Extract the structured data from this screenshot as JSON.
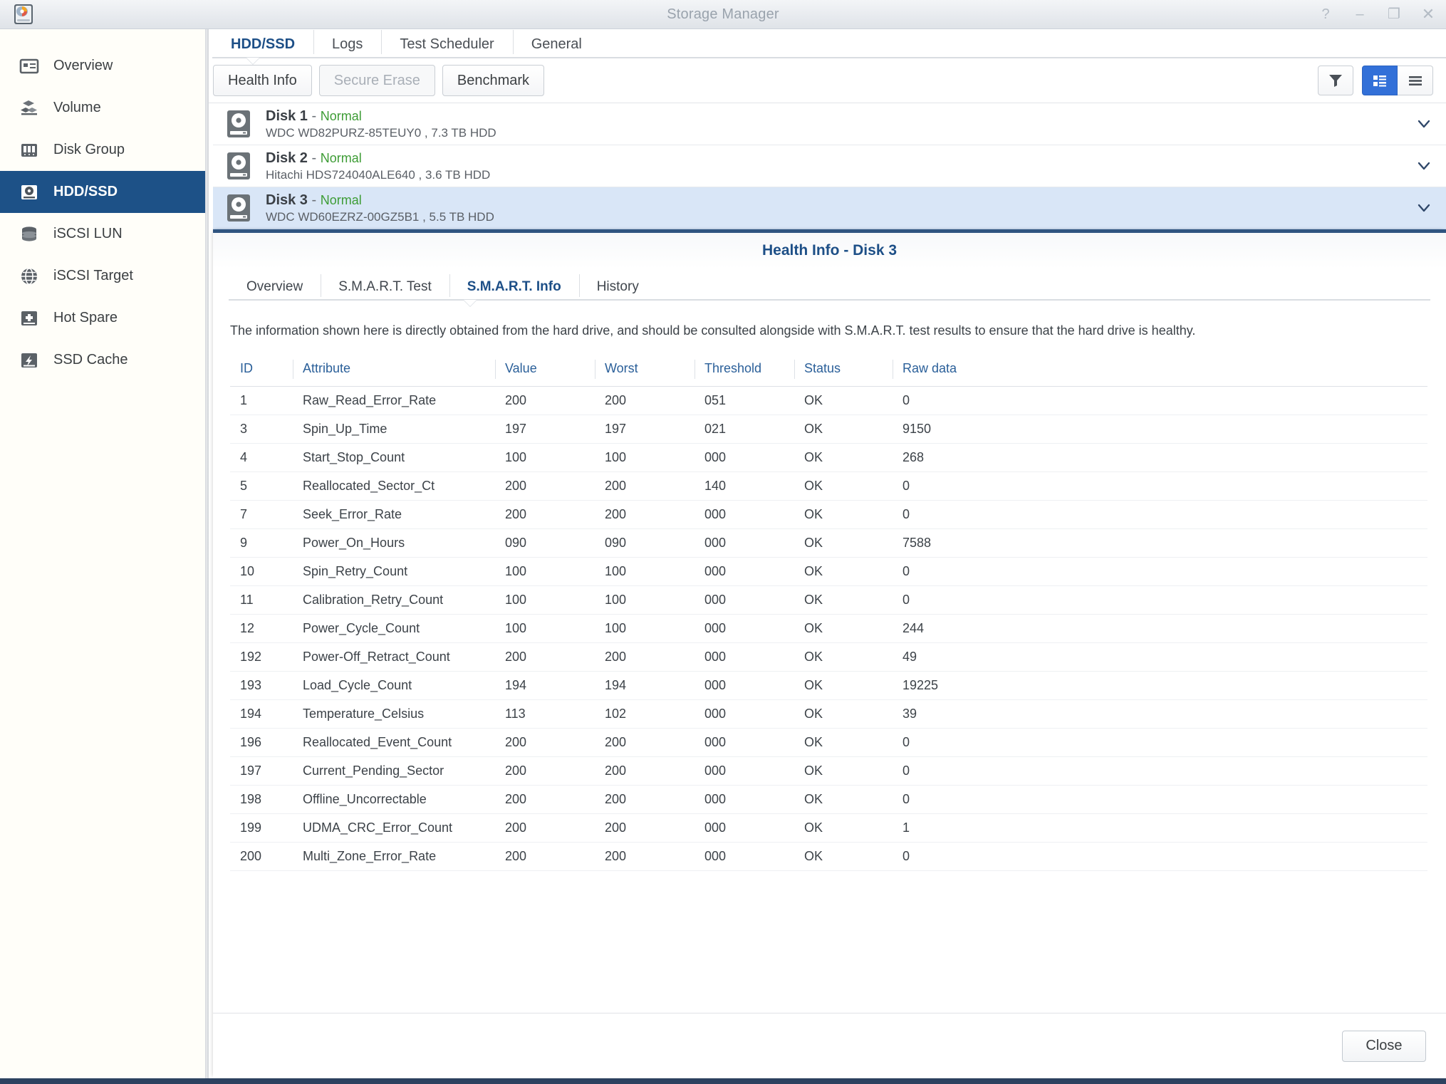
{
  "window": {
    "title": "Storage Manager",
    "controls": [
      {
        "name": "help-button",
        "glyph": "?"
      },
      {
        "name": "minimize-button",
        "glyph": "–"
      },
      {
        "name": "maximize-button",
        "glyph": "❐"
      },
      {
        "name": "close-window-button",
        "glyph": "✕"
      }
    ]
  },
  "sidebar": {
    "items": [
      {
        "label": "Overview",
        "icon": "overview-icon",
        "active": false
      },
      {
        "label": "Volume",
        "icon": "volume-icon",
        "active": false
      },
      {
        "label": "Disk Group",
        "icon": "disk-group-icon",
        "active": false
      },
      {
        "label": "HDD/SSD",
        "icon": "hdd-ssd-icon",
        "active": true
      },
      {
        "label": "iSCSI LUN",
        "icon": "iscsi-lun-icon",
        "active": false
      },
      {
        "label": "iSCSI Target",
        "icon": "iscsi-target-icon",
        "active": false
      },
      {
        "label": "Hot Spare",
        "icon": "hot-spare-icon",
        "active": false
      },
      {
        "label": "SSD Cache",
        "icon": "ssd-cache-icon",
        "active": false
      }
    ]
  },
  "main": {
    "tabs": [
      {
        "label": "HDD/SSD",
        "active": true
      },
      {
        "label": "Logs",
        "active": false
      },
      {
        "label": "Test Scheduler",
        "active": false
      },
      {
        "label": "General",
        "active": false
      }
    ],
    "toolbar": {
      "health_info_label": "Health Info",
      "secure_erase_label": "Secure Erase",
      "benchmark_label": "Benchmark",
      "filter_icon": "filter-icon",
      "detail_view_icon": "detail-view-icon",
      "list_view_icon": "list-view-icon"
    },
    "disks": [
      {
        "name": "Disk 1",
        "separator": "-",
        "status": "Normal",
        "model": "WDC WD82PURZ-85TEUY0 , 7.3 TB HDD",
        "selected": false
      },
      {
        "name": "Disk 2",
        "separator": "-",
        "status": "Normal",
        "model": "Hitachi HDS724040ALE640 , 3.6 TB HDD",
        "selected": false
      },
      {
        "name": "Disk 3",
        "separator": "-",
        "status": "Normal",
        "model": "WDC WD60EZRZ-00GZ5B1 , 5.5 TB HDD",
        "selected": true
      }
    ]
  },
  "health_panel": {
    "title": "Health Info - Disk 3",
    "tabs": [
      {
        "label": "Overview",
        "active": false
      },
      {
        "label": "S.M.A.R.T. Test",
        "active": false
      },
      {
        "label": "S.M.A.R.T. Info",
        "active": true
      },
      {
        "label": "History",
        "active": false
      }
    ],
    "description": "The information shown here is directly obtained from the hard drive, and should be consulted alongside with S.M.A.R.T. test results to ensure that the hard drive is healthy.",
    "close_label": "Close",
    "table": {
      "columns": [
        "ID",
        "Attribute",
        "Value",
        "Worst",
        "Threshold",
        "Status",
        "Raw data"
      ],
      "rows": [
        [
          "1",
          "Raw_Read_Error_Rate",
          "200",
          "200",
          "051",
          "OK",
          "0"
        ],
        [
          "3",
          "Spin_Up_Time",
          "197",
          "197",
          "021",
          "OK",
          "9150"
        ],
        [
          "4",
          "Start_Stop_Count",
          "100",
          "100",
          "000",
          "OK",
          "268"
        ],
        [
          "5",
          "Reallocated_Sector_Ct",
          "200",
          "200",
          "140",
          "OK",
          "0"
        ],
        [
          "7",
          "Seek_Error_Rate",
          "200",
          "200",
          "000",
          "OK",
          "0"
        ],
        [
          "9",
          "Power_On_Hours",
          "090",
          "090",
          "000",
          "OK",
          "7588"
        ],
        [
          "10",
          "Spin_Retry_Count",
          "100",
          "100",
          "000",
          "OK",
          "0"
        ],
        [
          "11",
          "Calibration_Retry_Count",
          "100",
          "100",
          "000",
          "OK",
          "0"
        ],
        [
          "12",
          "Power_Cycle_Count",
          "100",
          "100",
          "000",
          "OK",
          "244"
        ],
        [
          "192",
          "Power-Off_Retract_Count",
          "200",
          "200",
          "000",
          "OK",
          "49"
        ],
        [
          "193",
          "Load_Cycle_Count",
          "194",
          "194",
          "000",
          "OK",
          "19225"
        ],
        [
          "194",
          "Temperature_Celsius",
          "113",
          "102",
          "000",
          "OK",
          "39"
        ],
        [
          "196",
          "Reallocated_Event_Count",
          "200",
          "200",
          "000",
          "OK",
          "0"
        ],
        [
          "197",
          "Current_Pending_Sector",
          "200",
          "200",
          "000",
          "OK",
          "0"
        ],
        [
          "198",
          "Offline_Uncorrectable",
          "200",
          "200",
          "000",
          "OK",
          "0"
        ],
        [
          "199",
          "UDMA_CRC_Error_Count",
          "200",
          "200",
          "000",
          "OK",
          "1"
        ],
        [
          "200",
          "Multi_Zone_Error_Rate",
          "200",
          "200",
          "000",
          "OK",
          "0"
        ]
      ]
    }
  },
  "colors": {
    "accent": "#1d5187",
    "selection": "#d9e6f7",
    "status_ok": "#3d9c35",
    "panel_top_border": "#2f5480",
    "toggle_selected": "#3270d8"
  }
}
